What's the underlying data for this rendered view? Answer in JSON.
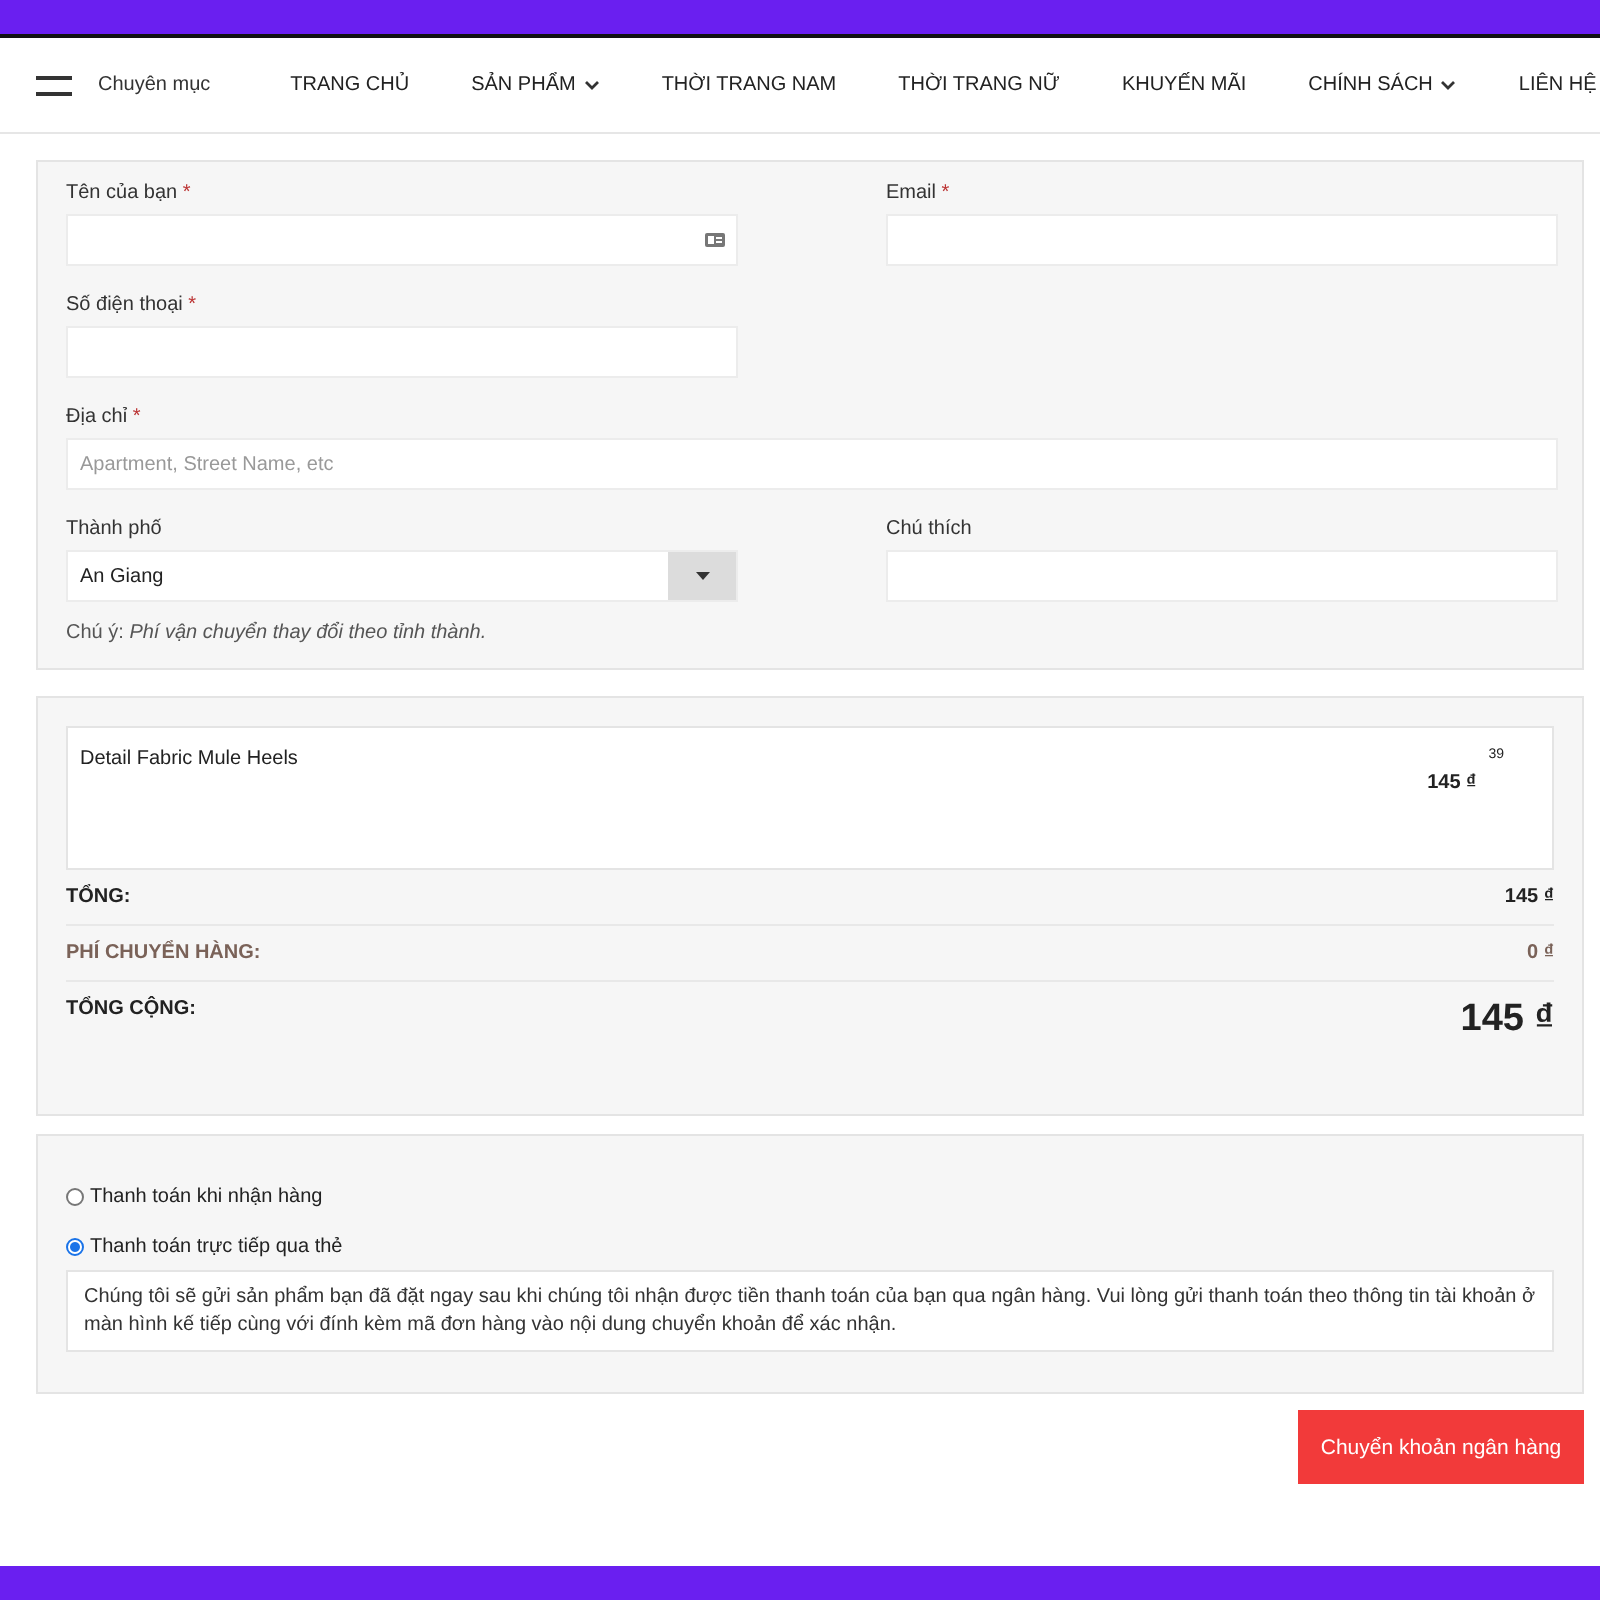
{
  "nav": {
    "category_label": "Chuyên mục",
    "items": [
      {
        "label": "TRANG CHỦ",
        "dropdown": false
      },
      {
        "label": "SẢN PHẨM",
        "dropdown": true
      },
      {
        "label": "THỜI TRANG NAM",
        "dropdown": false
      },
      {
        "label": "THỜI TRANG NỮ",
        "dropdown": false
      },
      {
        "label": "KHUYẾN MÃI",
        "dropdown": false
      },
      {
        "label": "CHÍNH SÁCH",
        "dropdown": true
      },
      {
        "label": "LIÊN HỆ",
        "dropdown": false
      }
    ]
  },
  "form": {
    "fields": [
      {
        "kind": "card_text",
        "label": "Tên của bạn",
        "required_mark": "*"
      },
      {
        "kind": "text",
        "label": "Email",
        "required_mark": "*"
      },
      {
        "kind": "text",
        "label": "Số điện thoại",
        "required_mark": "*"
      },
      {
        "kind": "spacer"
      },
      {
        "kind": "wide_text",
        "label": "Địa chỉ",
        "required_mark": "*",
        "placeholder": "Apartment, Street Name, etc"
      },
      {
        "kind": "select",
        "label": "Thành phố",
        "value": "An Giang"
      },
      {
        "kind": "text",
        "label": "Chú thích"
      }
    ],
    "note": "Chú ý: *Phí vận chuyển thay đổi theo tỉnh thành.*"
  },
  "order": {
    "items": [
      {
        "name": "Detail Fabric Mule Heels",
        "price": "145 ₫",
        "size": "39"
      }
    ],
    "subtotal": {
      "label": "TỔNG:",
      "value": "145 ₫"
    },
    "shipping": {
      "label": "PHÍ CHUYỂN HÀNG:",
      "value": "0 ₫"
    },
    "total": {
      "label": "TỔNG CỘNG:",
      "value": "145 ₫"
    }
  },
  "payment": {
    "methods": [
      {
        "label": "Thanh toán khi nhận hàng",
        "selected": false
      },
      {
        "label": "Thanh toán trực tiếp qua thẻ",
        "selected": true,
        "description": "Chúng tôi sẽ gửi sản phẩm bạn đã đặt ngay sau khi chúng tôi nhận được tiền thanh toán của bạn qua ngân hàng. Vui lòng gửi thanh toán theo thông tin tài khoản ở màn hình kế tiếp cùng với đính kèm mã đơn hàng vào nội dung chuyển khoản để xác nhận."
      }
    ]
  },
  "submit_button": "Chuyển khoản ngân hàng"
}
